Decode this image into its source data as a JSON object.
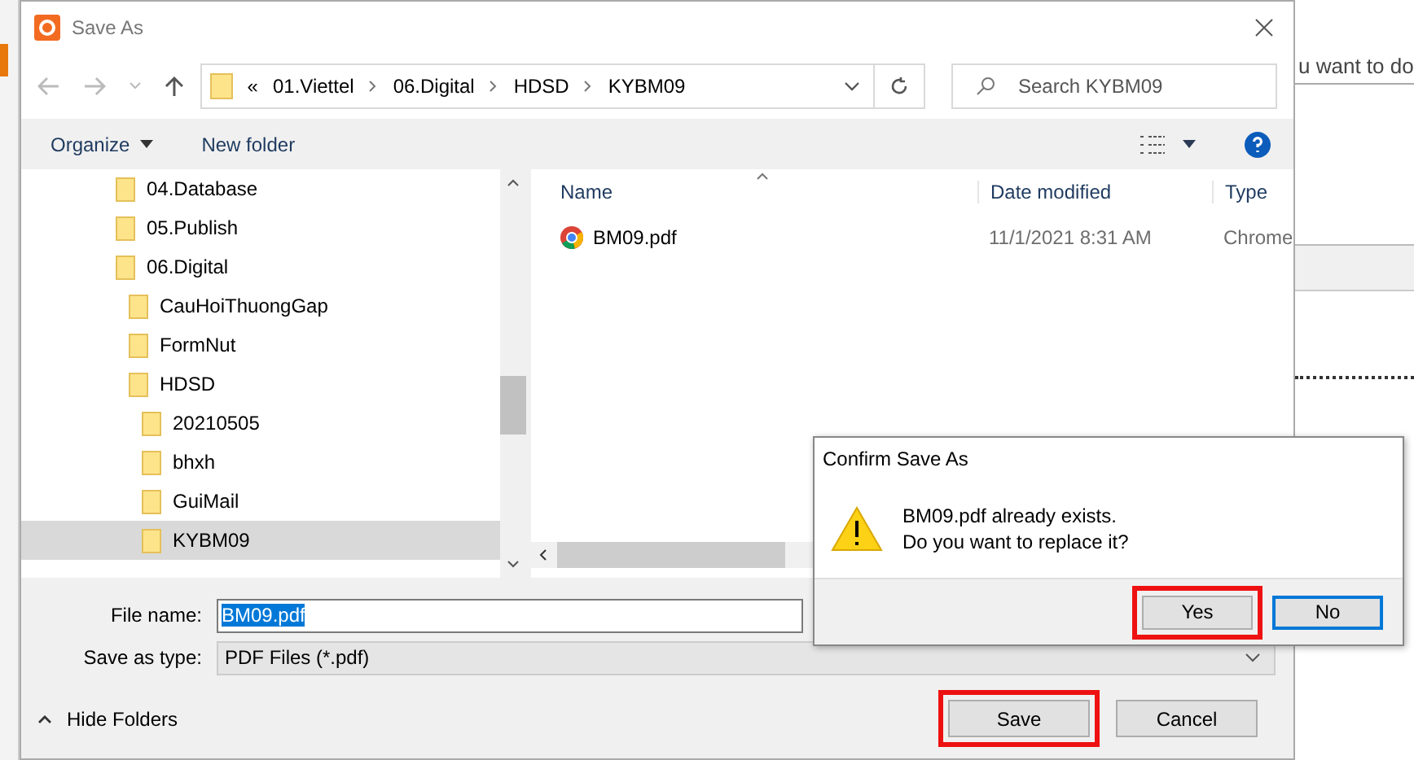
{
  "background_app": {
    "text": "u want to do"
  },
  "window": {
    "title": "Save As"
  },
  "address_bar": {
    "overflow": "«",
    "path": [
      "01.Viettel",
      "06.Digital",
      "HDSD",
      "KYBM09"
    ]
  },
  "search": {
    "placeholder": "Search KYBM09"
  },
  "toolbar": {
    "organize": "Organize",
    "new_folder": "New folder"
  },
  "folder_tree": [
    {
      "label": "04.Database",
      "selected": false
    },
    {
      "label": "05.Publish",
      "selected": false
    },
    {
      "label": "06.Digital",
      "selected": false,
      "children": [
        {
          "label": "CauHoiThuongGap",
          "selected": false
        },
        {
          "label": "FormNut",
          "selected": false
        },
        {
          "label": "HDSD",
          "selected": false,
          "children": [
            {
              "label": "20210505",
              "selected": false
            },
            {
              "label": "bhxh",
              "selected": false
            },
            {
              "label": "GuiMail",
              "selected": false
            },
            {
              "label": "KYBM09",
              "selected": true
            }
          ]
        }
      ]
    }
  ],
  "file_list": {
    "columns": [
      "Name",
      "Date modified",
      "Type"
    ],
    "rows": [
      {
        "name": "BM09.pdf",
        "date_modified": "11/1/2021 8:31 AM",
        "type": "Chrome"
      }
    ]
  },
  "file_name": {
    "label": "File name:",
    "value": "BM09.pdf",
    "text_selected": true
  },
  "save_as_type": {
    "label": "Save as type:",
    "value": "PDF Files (*.pdf)"
  },
  "hide_folders": "Hide Folders",
  "buttons": [
    {
      "label": "Save",
      "highlighted": true
    },
    {
      "label": "Cancel",
      "highlighted": false
    }
  ],
  "confirm_dialog": {
    "title": "Confirm Save As",
    "message": [
      "BM09.pdf already exists.",
      "Do you want to replace it?"
    ],
    "buttons": [
      {
        "label": "Yes",
        "highlighted": true,
        "default": false
      },
      {
        "label": "No",
        "highlighted": false,
        "default": true
      }
    ]
  }
}
